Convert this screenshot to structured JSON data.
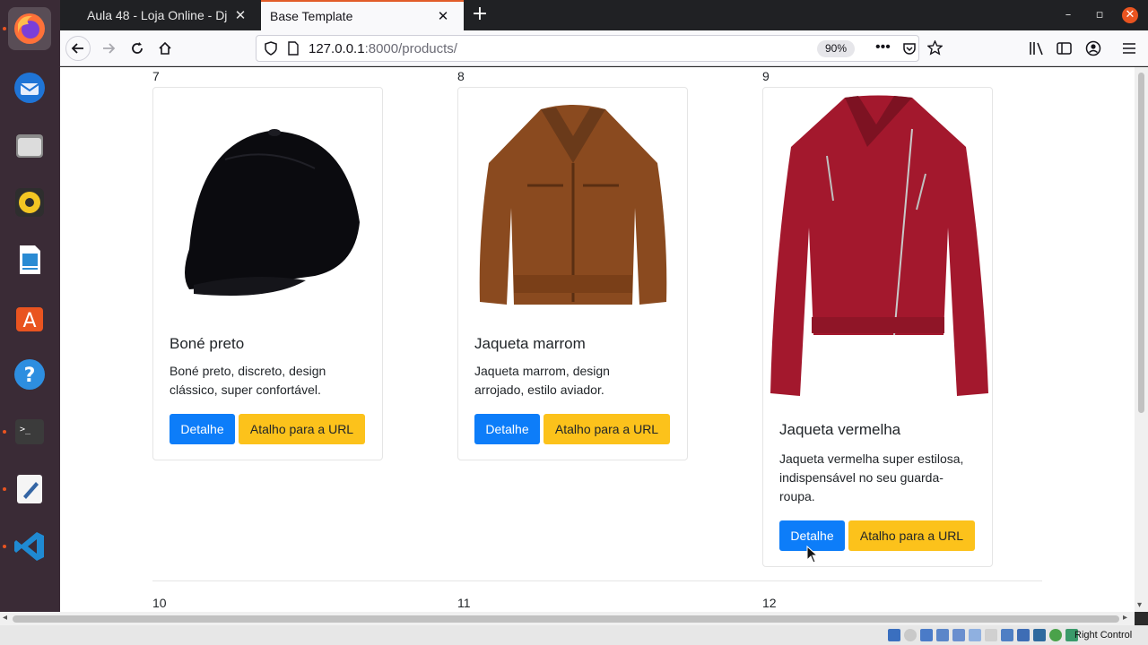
{
  "browser": {
    "tabs": [
      {
        "label": "Aula 48 - Loja Online - Dj",
        "active": false
      },
      {
        "label": "Base Template",
        "active": true
      }
    ],
    "url_host": "127.0.0.1",
    "url_path": ":8000/products/",
    "zoom": "90%"
  },
  "products": [
    {
      "number": "7",
      "title": "Boné preto",
      "text": "Boné preto, discreto, design clássico, super confortável.",
      "detail_label": "Detalhe",
      "url_label": "Atalho para a URL",
      "image": "black-cap"
    },
    {
      "number": "8",
      "title": "Jaqueta marrom",
      "text": "Jaqueta marrom, design arrojado, estilo aviador.",
      "detail_label": "Detalhe",
      "url_label": "Atalho para a URL",
      "image": "brown-jacket"
    },
    {
      "number": "9",
      "title": "Jaqueta vermelha",
      "text": "Jaqueta vermelha super estilosa, indispensável no seu guarda-roupa.",
      "detail_label": "Detalhe",
      "url_label": "Atalho para a URL",
      "image": "red-jacket"
    }
  ],
  "next_row": [
    "10",
    "11",
    "12"
  ],
  "tray": {
    "label": "Right Control"
  },
  "colors": {
    "primary": "#0d7df9",
    "warning": "#fcc21b",
    "dock": "#3a2b36",
    "accent": "#e25c29"
  }
}
